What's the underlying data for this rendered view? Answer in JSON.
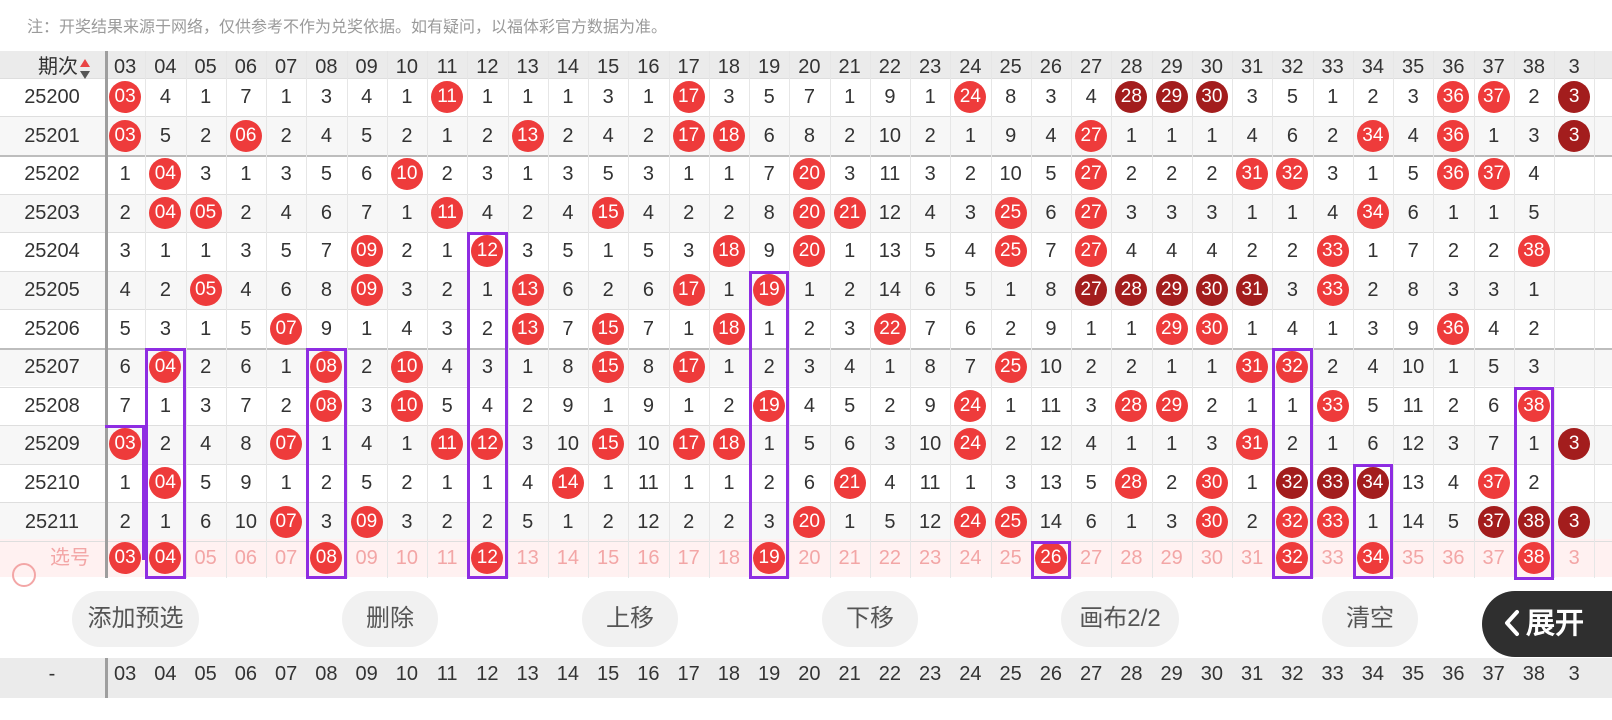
{
  "notice": "注：开奖结果来源于网络，仅供参考不作为兑奖依据。如有疑问，以福体彩官方数据为准。",
  "header": {
    "period_label": "期次",
    "footer_label": "-"
  },
  "columns": [
    "03",
    "04",
    "05",
    "06",
    "07",
    "08",
    "09",
    "10",
    "11",
    "12",
    "13",
    "14",
    "15",
    "16",
    "17",
    "18",
    "19",
    "20",
    "21",
    "22",
    "23",
    "24",
    "25",
    "26",
    "27",
    "28",
    "29",
    "30",
    "31",
    "32",
    "33",
    "34",
    "35",
    "36",
    "37",
    "38",
    "3"
  ],
  "rows": [
    {
      "issue": "25200",
      "cells": [
        "03",
        "4",
        "1",
        "7",
        "1",
        "3",
        "4",
        "1",
        "11",
        "1",
        "1",
        "1",
        "3",
        "1",
        "17",
        "3",
        "5",
        "7",
        "1",
        "9",
        "1",
        "24",
        "8",
        "3",
        "4",
        "28",
        "29",
        "30",
        "3",
        "5",
        "1",
        "2",
        "3",
        "36",
        "37",
        "2",
        "3"
      ]
    },
    {
      "issue": "25201",
      "cells": [
        "03",
        "5",
        "2",
        "06",
        "2",
        "4",
        "5",
        "2",
        "1",
        "2",
        "13",
        "2",
        "4",
        "2",
        "17",
        "18",
        "6",
        "8",
        "2",
        "10",
        "2",
        "1",
        "9",
        "4",
        "27",
        "1",
        "1",
        "1",
        "4",
        "6",
        "2",
        "34",
        "4",
        "36",
        "1",
        "3",
        "3"
      ]
    },
    {
      "issue": "25202",
      "cells": [
        "1",
        "04",
        "3",
        "1",
        "3",
        "5",
        "6",
        "10",
        "2",
        "3",
        "1",
        "3",
        "5",
        "3",
        "1",
        "1",
        "7",
        "20",
        "3",
        "11",
        "3",
        "2",
        "10",
        "5",
        "27",
        "2",
        "2",
        "2",
        "31",
        "32",
        "3",
        "1",
        "5",
        "36",
        "37",
        "4",
        ""
      ]
    },
    {
      "issue": "25203",
      "cells": [
        "2",
        "04",
        "05",
        "2",
        "4",
        "6",
        "7",
        "1",
        "11",
        "4",
        "2",
        "4",
        "15",
        "4",
        "2",
        "2",
        "8",
        "20",
        "21",
        "12",
        "4",
        "3",
        "25",
        "6",
        "27",
        "3",
        "3",
        "3",
        "1",
        "1",
        "4",
        "34",
        "6",
        "1",
        "1",
        "5",
        ""
      ]
    },
    {
      "issue": "25204",
      "cells": [
        "3",
        "1",
        "1",
        "3",
        "5",
        "7",
        "09",
        "2",
        "1",
        "12",
        "3",
        "5",
        "1",
        "5",
        "3",
        "18",
        "9",
        "20",
        "1",
        "13",
        "5",
        "4",
        "25",
        "7",
        "27",
        "4",
        "4",
        "4",
        "2",
        "2",
        "33",
        "1",
        "7",
        "2",
        "2",
        "38",
        ""
      ]
    },
    {
      "issue": "25205",
      "cells": [
        "4",
        "2",
        "05",
        "4",
        "6",
        "8",
        "09",
        "3",
        "2",
        "1",
        "13",
        "6",
        "2",
        "6",
        "17",
        "1",
        "19",
        "1",
        "2",
        "14",
        "6",
        "5",
        "1",
        "8",
        "27",
        "28",
        "29",
        "30",
        "31",
        "3",
        "33",
        "2",
        "8",
        "3",
        "3",
        "1",
        ""
      ]
    },
    {
      "issue": "25206",
      "cells": [
        "5",
        "3",
        "1",
        "5",
        "07",
        "9",
        "1",
        "4",
        "3",
        "2",
        "13",
        "7",
        "15",
        "7",
        "1",
        "18",
        "1",
        "2",
        "3",
        "22",
        "7",
        "6",
        "2",
        "9",
        "1",
        "1",
        "29",
        "30",
        "1",
        "4",
        "1",
        "3",
        "9",
        "36",
        "4",
        "2",
        ""
      ]
    },
    {
      "issue": "25207",
      "cells": [
        "6",
        "04",
        "2",
        "6",
        "1",
        "08",
        "2",
        "10",
        "4",
        "3",
        "1",
        "8",
        "15",
        "8",
        "17",
        "1",
        "2",
        "3",
        "4",
        "1",
        "8",
        "7",
        "25",
        "10",
        "2",
        "2",
        "1",
        "1",
        "31",
        "32",
        "2",
        "4",
        "10",
        "1",
        "5",
        "3",
        ""
      ]
    },
    {
      "issue": "25208",
      "cells": [
        "7",
        "1",
        "3",
        "7",
        "2",
        "08",
        "3",
        "10",
        "5",
        "4",
        "2",
        "9",
        "1",
        "9",
        "1",
        "2",
        "19",
        "4",
        "5",
        "2",
        "9",
        "24",
        "1",
        "11",
        "3",
        "28",
        "29",
        "2",
        "1",
        "1",
        "33",
        "5",
        "11",
        "2",
        "6",
        "38",
        ""
      ]
    },
    {
      "issue": "25209",
      "cells": [
        "03",
        "2",
        "4",
        "8",
        "07",
        "1",
        "4",
        "1",
        "11",
        "12",
        "3",
        "10",
        "15",
        "10",
        "17",
        "18",
        "1",
        "5",
        "6",
        "3",
        "10",
        "24",
        "2",
        "12",
        "4",
        "1",
        "1",
        "3",
        "31",
        "2",
        "1",
        "6",
        "12",
        "3",
        "7",
        "1",
        "3"
      ]
    },
    {
      "issue": "25210",
      "cells": [
        "1",
        "04",
        "5",
        "9",
        "1",
        "2",
        "5",
        "2",
        "1",
        "1",
        "4",
        "14",
        "1",
        "11",
        "1",
        "1",
        "2",
        "6",
        "21",
        "4",
        "11",
        "1",
        "3",
        "13",
        "5",
        "28",
        "2",
        "30",
        "1",
        "32",
        "33",
        "34",
        "13",
        "4",
        "37",
        "2",
        ""
      ]
    },
    {
      "issue": "25211",
      "cells": [
        "2",
        "1",
        "6",
        "10",
        "07",
        "3",
        "09",
        "3",
        "2",
        "2",
        "5",
        "1",
        "2",
        "12",
        "2",
        "2",
        "3",
        "20",
        "1",
        "5",
        "12",
        "24",
        "25",
        "14",
        "6",
        "1",
        "3",
        "30",
        "2",
        "32",
        "33",
        "1",
        "14",
        "5",
        "37",
        "38",
        "3"
      ]
    }
  ],
  "dark_balls": {
    "25200": [
      "28",
      "29",
      "30"
    ],
    "25205": [
      "27",
      "28",
      "29",
      "30",
      "31"
    ],
    "25210": [
      "32",
      "33",
      "34"
    ],
    "25211": [
      "37",
      "38"
    ],
    "25201": [
      "3"
    ]
  },
  "selection": {
    "label": "选号",
    "selected": [
      "03",
      "04",
      "08",
      "12",
      "19",
      "26",
      "32",
      "34",
      "38"
    ]
  },
  "buttons": {
    "add_preset": "添加预选",
    "delete": "删除",
    "move_up": "上移",
    "move_down": "下移",
    "canvas": "画布2/2",
    "clear": "清空",
    "expand": "展开"
  },
  "colors": {
    "ball_red": "#ee3b3b",
    "ball_dark": "#a31d1d",
    "box_purple": "#8e2de2",
    "selected_row_bg": "#fff1f1"
  }
}
